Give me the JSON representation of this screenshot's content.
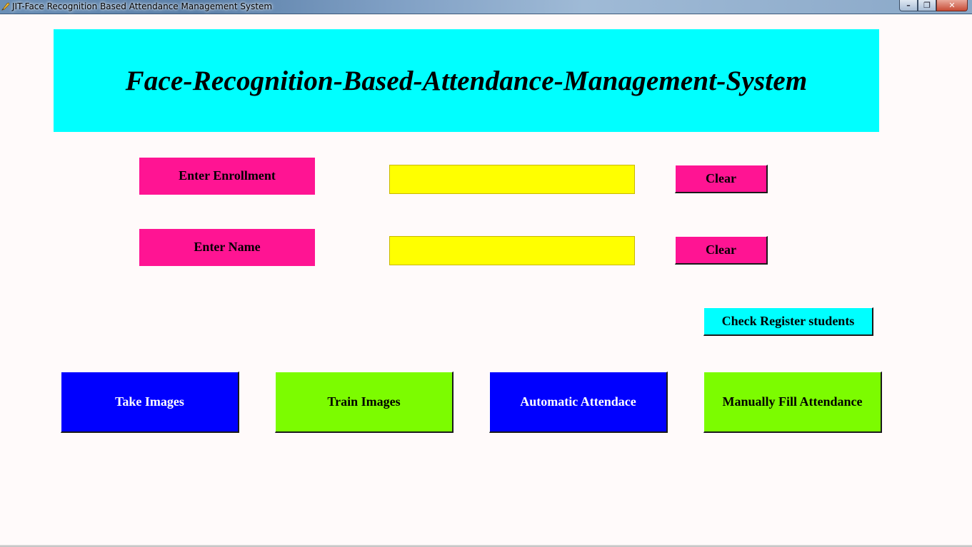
{
  "window": {
    "title": "JIT-Face Recognition Based Attendance Management System",
    "minimize_symbol": "–",
    "maximize_symbol": "❐",
    "close_symbol": "✕"
  },
  "header": {
    "title": "Face-Recognition-Based-Attendance-Management-System"
  },
  "form": {
    "enrollment": {
      "label": "Enter Enrollment",
      "value": "",
      "clear_label": "Clear"
    },
    "name": {
      "label": "Enter Name",
      "value": "",
      "clear_label": "Clear"
    }
  },
  "actions": {
    "check_register_label": "Check Register students",
    "take_images_label": "Take Images",
    "train_images_label": "Train Images",
    "automatic_attendance_label": "Automatic Attendace",
    "manual_attendance_label": "Manually Fill Attendance"
  },
  "colors": {
    "background": "#fffafa",
    "banner": "#00ffff",
    "label_pink": "#ff1493",
    "input_yellow": "#ffff00",
    "button_blue": "#0000ff",
    "button_green": "#7cfc00",
    "button_cyan": "#00ffff"
  },
  "icons": {
    "app_icon": "feather-pen-icon"
  }
}
